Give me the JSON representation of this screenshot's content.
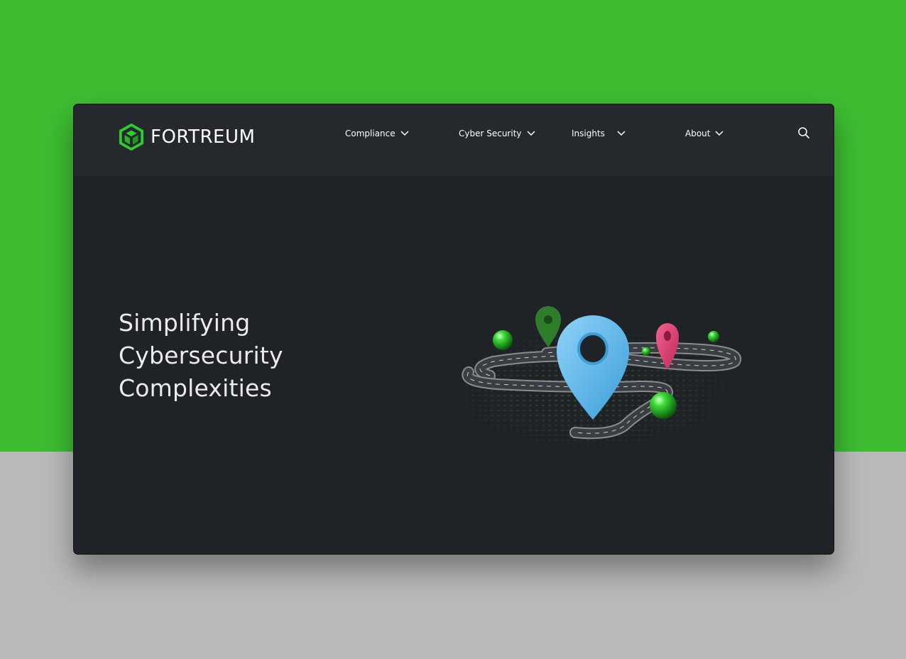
{
  "brand": {
    "name": "FORTREUM",
    "logo_icon": "fortreum-cube-icon",
    "color": "#3dbc31"
  },
  "nav": {
    "items": [
      {
        "label": "Compliance",
        "icon": "chevron-down-icon"
      },
      {
        "label": "Cyber Security",
        "icon": "chevron-down-icon"
      },
      {
        "label": "Insights",
        "icon": "chevron-down-icon"
      },
      {
        "label": "About",
        "icon": "chevron-down-icon"
      }
    ],
    "search_icon": "search-icon"
  },
  "hero": {
    "title_lines": [
      "Simplifying",
      "Cybersecurity",
      "Complexities"
    ],
    "illustration": "map-pins-on-winding-road"
  },
  "colors": {
    "page_green": "#3dbc31",
    "navbar_bg": "#25282c",
    "hero_bg": "#1f2227",
    "pin_blue": "#58b9ee",
    "pin_pink": "#e03a6e",
    "pin_green": "#2e7d2a"
  }
}
